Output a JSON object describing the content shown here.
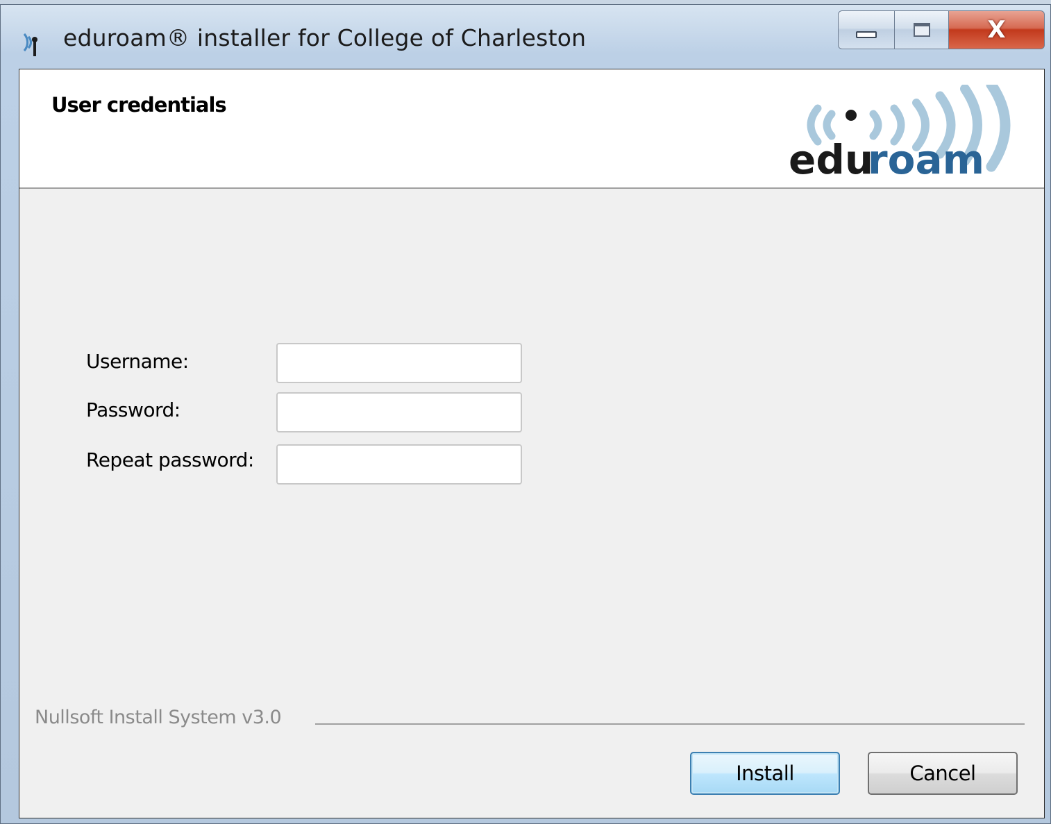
{
  "window": {
    "title": "eduroam® installer for College of Charleston",
    "controls": {
      "minimize_icon": "minimize-icon",
      "maximize_icon": "maximize-icon",
      "close_icon": "close-icon",
      "close_glyph": "X"
    }
  },
  "header": {
    "title": "User credentials",
    "logo": {
      "icon": "eduroam-logo",
      "text_dark": "edu",
      "text_accent": "roam",
      "accent_color": "#2a6496",
      "wave_color": "#a9c8dc"
    }
  },
  "form": {
    "fields": [
      {
        "label": "Username:",
        "value": "",
        "type": "text"
      },
      {
        "label": "Password:",
        "value": "",
        "type": "password"
      },
      {
        "label": "Repeat password:",
        "value": "",
        "type": "password"
      }
    ]
  },
  "footer": {
    "branding": "Nullsoft Install System v3.0",
    "install_label": "Install",
    "cancel_label": "Cancel"
  }
}
